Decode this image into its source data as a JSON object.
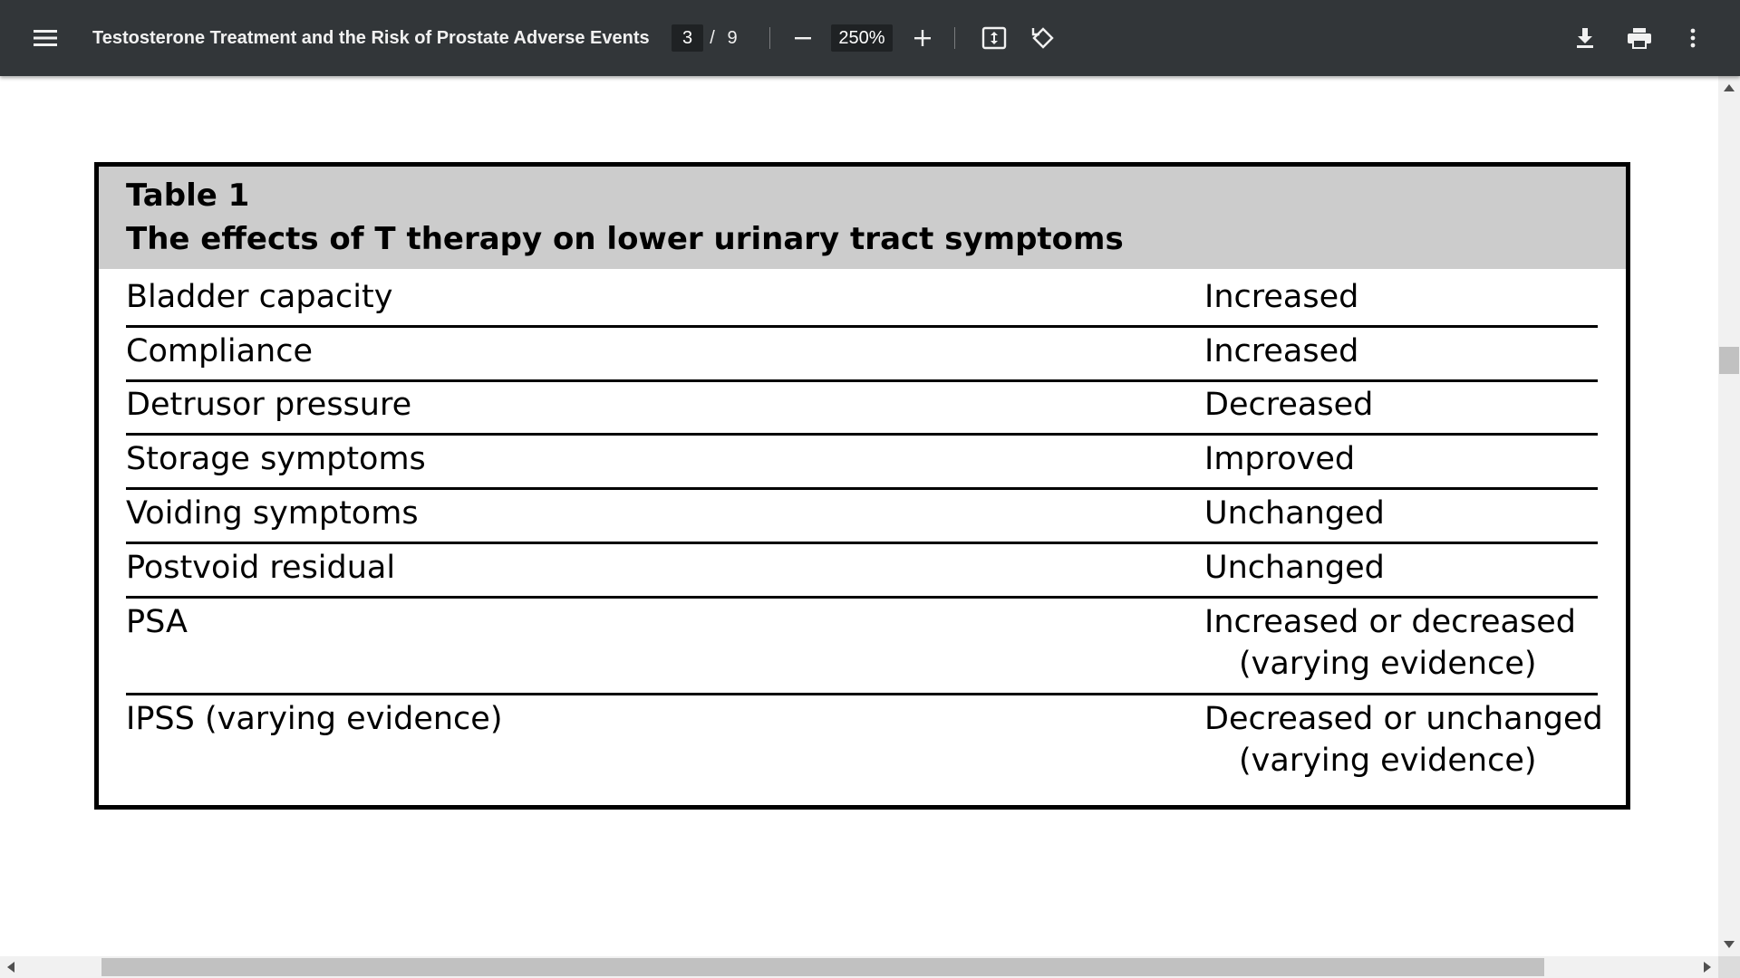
{
  "toolbar": {
    "title": "Testosterone Treatment and the Risk of Prostate Adverse Events",
    "page_current": "3",
    "page_separator": "/",
    "page_total": "9",
    "zoom": "250%",
    "icons": {
      "menu": "menu-icon",
      "zoom_out": "minus-icon",
      "zoom_in": "plus-icon",
      "fit": "fit-to-page-icon",
      "rotate": "rotate-icon",
      "download": "download-icon",
      "print": "print-icon",
      "more": "more-vertical-icon"
    },
    "colors": {
      "background": "#323639",
      "input_background": "#1f2224",
      "text": "#f1f1f1"
    }
  },
  "table": {
    "label": "Table 1",
    "caption": "The effects of T therapy on lower urinary tract symptoms",
    "header_background": "#cccccc",
    "rows": [
      {
        "parameter": "Bladder capacity",
        "effect": "Increased",
        "effect_line2": ""
      },
      {
        "parameter": "Compliance",
        "effect": "Increased",
        "effect_line2": ""
      },
      {
        "parameter": "Detrusor pressure",
        "effect": "Decreased",
        "effect_line2": ""
      },
      {
        "parameter": "Storage symptoms",
        "effect": "Improved",
        "effect_line2": ""
      },
      {
        "parameter": "Voiding symptoms",
        "effect": "Unchanged",
        "effect_line2": ""
      },
      {
        "parameter": "Postvoid residual",
        "effect": "Unchanged",
        "effect_line2": ""
      },
      {
        "parameter": "PSA",
        "effect": "Increased or decreased",
        "effect_line2": "(varying evidence)"
      },
      {
        "parameter": "IPSS (varying evidence)",
        "effect": "Decreased or unchanged",
        "effect_line2": "(varying evidence)"
      }
    ]
  }
}
